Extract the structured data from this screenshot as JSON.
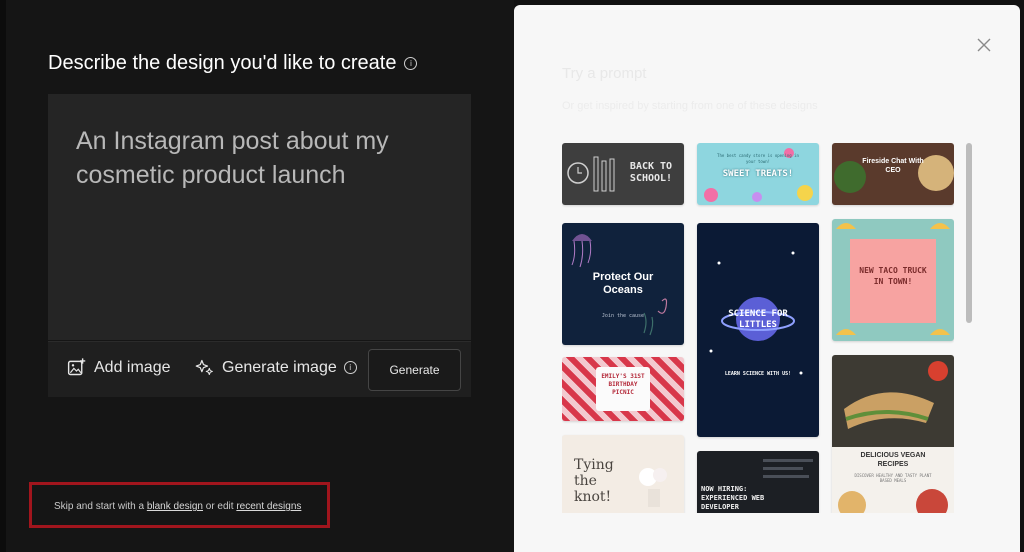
{
  "left": {
    "title": "Describe the design you'd like to create",
    "info_glyph": "i",
    "prompt_text": "An Instagram post about my cosmetic product launch",
    "add_image_label": "Add image",
    "generate_image_label": "Generate image",
    "generate_button_label": "Generate",
    "skip": {
      "prefix": "Skip and start with a ",
      "blank_design": "blank design",
      "middle": " or edit ",
      "recent_designs": "recent designs"
    }
  },
  "right": {
    "ghost_title": "Try a prompt",
    "ghost_subtitle": "Or get inspired by starting from one of these designs",
    "templates": [
      {
        "text": "BACK TO SCHOOL!"
      },
      {
        "text": "SWEET TREATS!",
        "sub": "The best candy store is opening in your town!"
      },
      {
        "text": "Fireside Chat With CEO"
      },
      {
        "text": "Protect Our Oceans",
        "sub": "Join the cause"
      },
      {
        "text": "SCIENCE FOR LITTLES",
        "sub": "LEARN SCIENCE WITH US!"
      },
      {
        "text": "NEW TACO TRUCK IN TOWN!"
      },
      {
        "text": "EMILY'S 31ST BIRTHDAY PICNIC"
      },
      {
        "text": "DELICIOUS VEGAN RECIPES",
        "sub": "DISCOVER HEALTHY AND TASTY PLANT BASED MEALS"
      },
      {
        "text": "Tying the knot!"
      },
      {
        "text": "NOW HIRING: EXPERIENCED WEB DEVELOPER"
      }
    ]
  },
  "colors": {
    "left_bg": "#151515",
    "prompt_bg": "#252525",
    "highlight_border": "#a1151d",
    "right_bg": "#f7f7f7"
  },
  "icons": [
    "info-icon",
    "add-image-icon",
    "sparkle-icon",
    "close-icon"
  ]
}
